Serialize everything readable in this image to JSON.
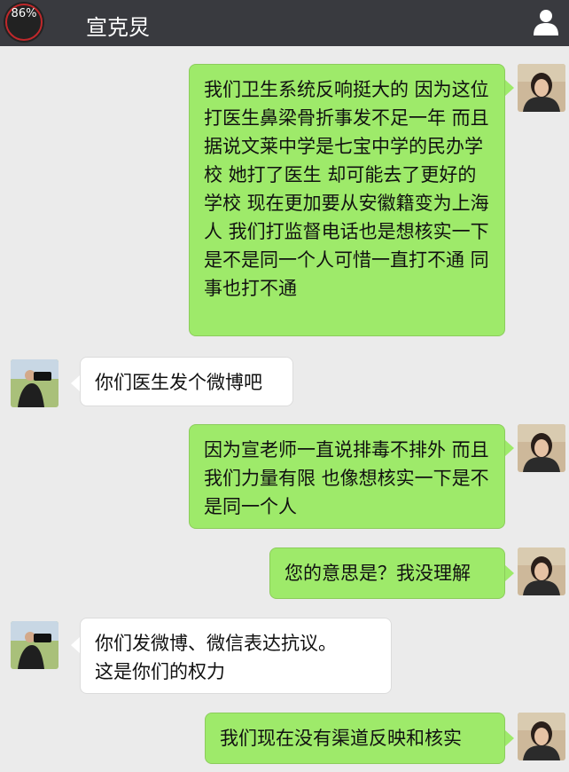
{
  "status": {
    "battery": "86%"
  },
  "header": {
    "title": "宣克炅",
    "profile_icon": "person-icon"
  },
  "messages": [
    {
      "side": "right",
      "text": "我们卫生系统反响挺大的 因为这位打医生鼻梁骨折事发不足一年 而且据说文莱中学是七宝中学的民办学校 她打了医生 却可能去了更好的学校 现在更加要从安徽籍变为上海人 我们打监督电话也是想核实一下是不是同一个人可惜一直打不通 同事也打不通"
    },
    {
      "side": "left",
      "text": "你们医生发个微博吧"
    },
    {
      "side": "right",
      "text": "因为宣老师一直说排毒不排外 而且我们力量有限 也像想核实一下是不是同一个人"
    },
    {
      "side": "right",
      "text": "您的意思是？我没理解"
    },
    {
      "side": "left",
      "text": "你们发微博、微信表达抗议。\n这是你们的权力"
    },
    {
      "side": "right",
      "text": "我们现在没有渠道反映和核实"
    }
  ],
  "colors": {
    "header": "#393a3f",
    "background": "#ebebeb",
    "sent_bubble": "#9eea6a",
    "received_bubble": "#ffffff"
  }
}
